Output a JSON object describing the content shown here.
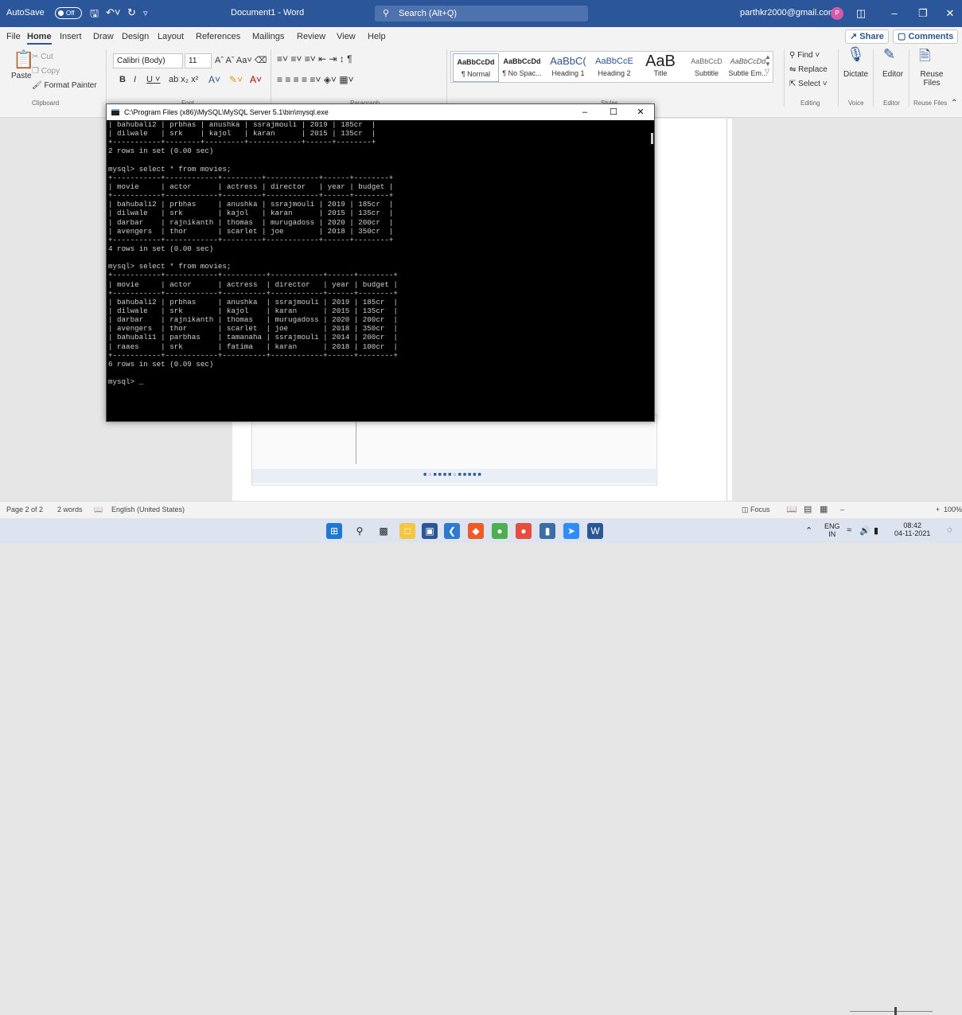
{
  "titlebar": {
    "autosave": "AutoSave",
    "autosave_state": "Off",
    "doc_title": "Document1 - Word",
    "search_placeholder": "Search (Alt+Q)",
    "account": "parthkr2000@gmail.com",
    "avatar_letter": "P"
  },
  "menu": {
    "items": [
      "File",
      "Home",
      "Insert",
      "Draw",
      "Design",
      "Layout",
      "References",
      "Mailings",
      "Review",
      "View",
      "Help"
    ],
    "share": "Share",
    "comments": "Comments"
  },
  "ribbon": {
    "clipboard": {
      "paste": "Paste",
      "cut": "Cut",
      "copy": "Copy",
      "format_painter": "Format Painter",
      "label": "Clipboard"
    },
    "font": {
      "name": "Calibri (Body)",
      "size": "11",
      "label": "Font"
    },
    "paragraph": {
      "label": "Paragraph"
    },
    "styles": {
      "label": "Styles",
      "items": [
        {
          "preview": "AaBbCcDd",
          "name": "¶ Normal"
        },
        {
          "preview": "AaBbCcDd",
          "name": "¶ No Spac..."
        },
        {
          "preview": "AaBbC(",
          "name": "Heading 1"
        },
        {
          "preview": "AaBbCcE",
          "name": "Heading 2"
        },
        {
          "preview": "AaB",
          "name": "Title"
        },
        {
          "preview": "AaBbCcD",
          "name": "Subtitle"
        },
        {
          "preview": "AaBbCcDd",
          "name": "Subtle Em..."
        }
      ]
    },
    "editing": {
      "find": "Find",
      "replace": "Replace",
      "select": "Select",
      "label": "Editing"
    },
    "voice": {
      "dictate": "Dictate",
      "label": "Voice"
    },
    "editor": {
      "editor": "Editor",
      "label": "Editor"
    },
    "reuse": {
      "reuse": "Reuse Files",
      "label": "Reuse Files"
    }
  },
  "console": {
    "title": "C:\\Program Files (x86)\\MySQL\\MySQL Server 5.1\\bin\\mysql.exe",
    "lines": [
      "| bahubali2 | prbhas | anushka | ssrajmouli | 2019 | 185cr  |",
      "| dilwale   | srk    | kajol   | karan      | 2015 | 135cr  |",
      "+-----------+--------+---------+------------+------+--------+",
      "2 rows in set (0.00 sec)",
      "",
      "mysql> select * from movies;",
      "+-----------+------------+---------+------------+------+--------+",
      "| movie     | actor      | actress | director   | year | budget |",
      "+-----------+------------+---------+------------+------+--------+",
      "| bahubali2 | prbhas     | anushka | ssrajmouli | 2019 | 185cr  |",
      "| dilwale   | srk        | kajol   | karan      | 2015 | 135cr  |",
      "| darbar    | rajnikanth | thomas  | murugadoss | 2020 | 200cr  |",
      "| avengers  | thor       | scarlet | joe        | 2018 | 350cr  |",
      "+-----------+------------+---------+------------+------+--------+",
      "4 rows in set (0.00 sec)",
      "",
      "mysql> select * from movies;",
      "+-----------+------------+----------+------------+------+--------+",
      "| movie     | actor      | actress  | director   | year | budget |",
      "+-----------+------------+----------+------------+------+--------+",
      "| bahubali2 | prbhas     | anushka  | ssrajmouli | 2019 | 185cr  |",
      "| dilwale   | srk        | kajol    | karan      | 2015 | 135cr  |",
      "| darbar    | rajnikanth | thomas   | murugadoss | 2020 | 200cr  |",
      "| avengers  | thor       | scarlet  | joe        | 2018 | 350cr  |",
      "| bahubali1 | parbhas    | tamanaha | ssrajmouli | 2014 | 200cr  |",
      "| raaes     | srk        | fatima   | karan      | 2018 | 100cr  |",
      "+-----------+------------+----------+------------+------+--------+",
      "6 rows in set (0.09 sec)",
      "",
      "mysql> _"
    ]
  },
  "status": {
    "page": "Page 2 of 2",
    "words": "2 words",
    "language": "English (United States)",
    "focus": "Focus",
    "zoom": "100%"
  },
  "taskbar": {
    "lang": "ENG",
    "region": "IN",
    "time": "08:42",
    "date": "04-11-2021"
  }
}
